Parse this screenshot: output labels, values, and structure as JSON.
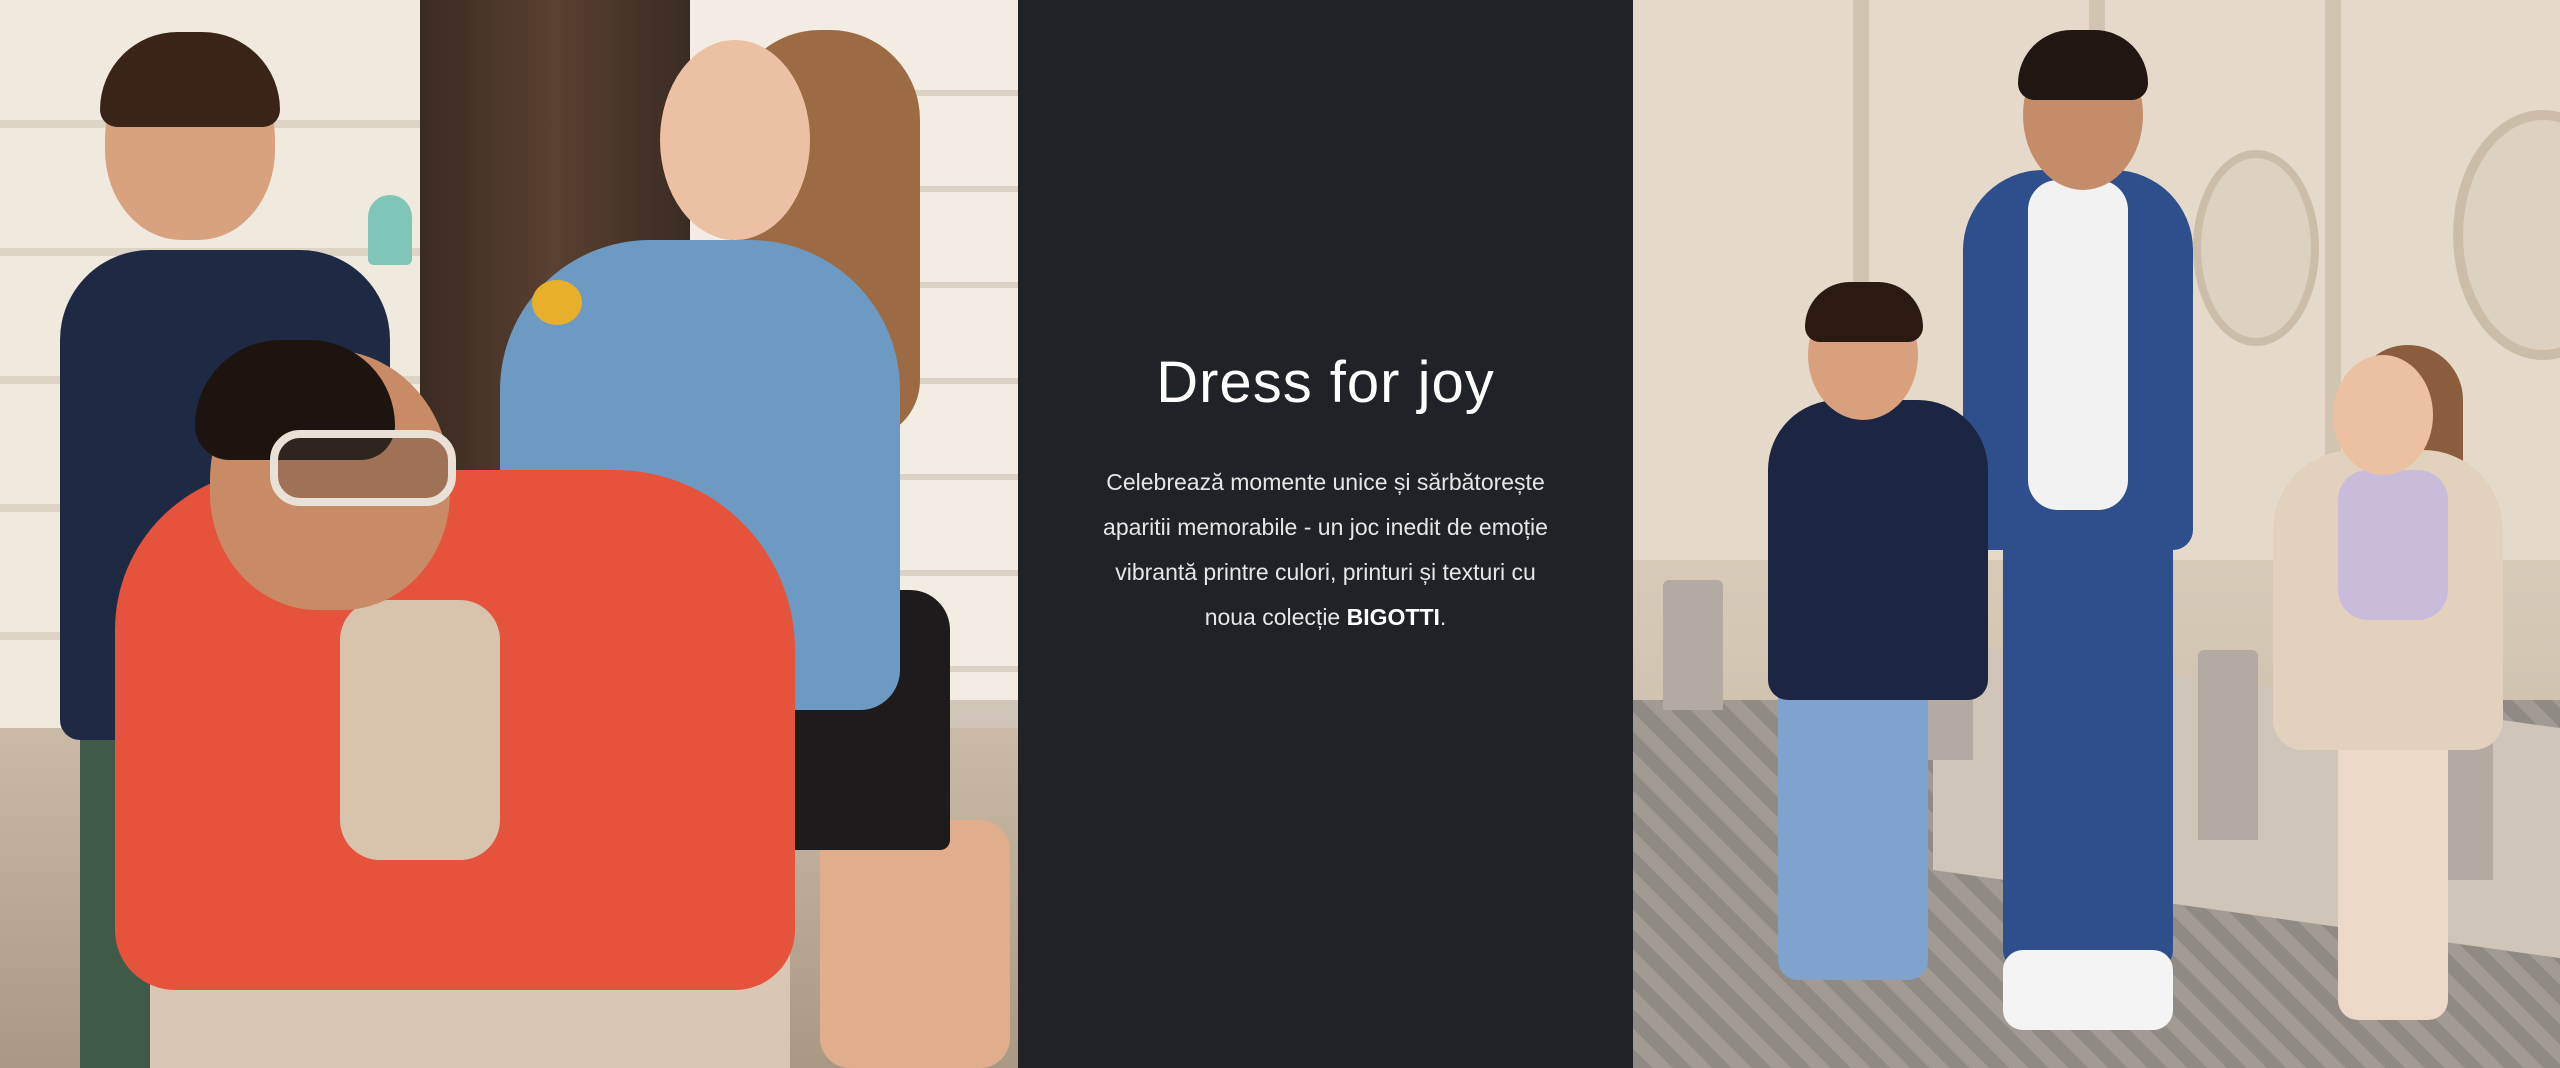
{
  "hero": {
    "headline": "Dress for joy",
    "body_lines": [
      "Celebrează momente unice și sărbătorește",
      "aparitii memorabile - un joc inedit de emoție",
      "vibrantă printre culori, printuri și texturi cu",
      "noua colecție "
    ],
    "brand": "BIGOTTI",
    "trailing": "."
  },
  "colors": {
    "center_background": "#1f2226",
    "headline": "#ffffff",
    "body_text": "#e6e6e6"
  },
  "images": {
    "left_photo": "family-photo-ice-cream",
    "right_photo": "father-children-walking-street"
  }
}
